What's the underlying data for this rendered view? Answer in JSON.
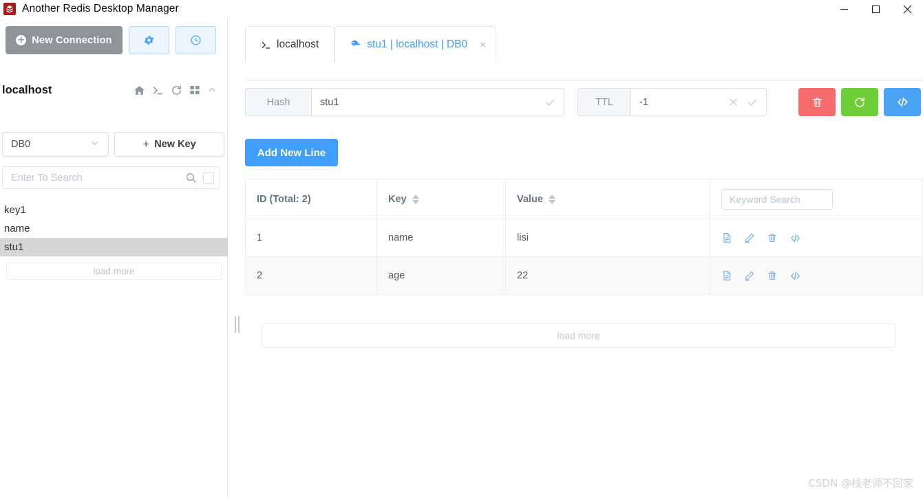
{
  "window": {
    "title": "Another Redis Desktop Manager",
    "icon": "redis-app-icon",
    "controls": {
      "minimize": "minimize-icon",
      "maximize": "maximize-icon",
      "close": "close-icon"
    }
  },
  "sidebar": {
    "new_connection_label": "New Connection",
    "settings_icon": "gear-icon",
    "history_icon": "clock-icon",
    "server_name": "localhost",
    "header_icons": [
      "home-icon",
      "terminal-icon",
      "refresh-icon",
      "grid-icon",
      "chevron-up-icon"
    ],
    "db_select_value": "DB0",
    "new_key_label": "New Key",
    "search_placeholder": "Enter To Search",
    "keys": [
      "key1",
      "name",
      "stu1"
    ],
    "selected_key": "stu1",
    "load_more_label": "load more"
  },
  "tabs": [
    {
      "label": "localhost",
      "icon": "terminal-icon",
      "active": false,
      "closable": false
    },
    {
      "label": "stu1 | localhost | DB0",
      "icon": "key-icon",
      "active": true,
      "closable": true,
      "close_label": "×"
    }
  ],
  "keybar": {
    "type_label": "Hash",
    "key_name": "stu1",
    "key_confirm_icon": "check-icon",
    "ttl_label": "TTL",
    "ttl_value": "-1",
    "ttl_clear_icon": "close-icon",
    "ttl_confirm_icon": "check-icon",
    "actions": [
      {
        "name": "delete-key-button",
        "icon": "trash-icon",
        "color": "#f56c6c"
      },
      {
        "name": "refresh-key-button",
        "icon": "refresh-icon",
        "color": "#6ece3a"
      },
      {
        "name": "code-view-button",
        "icon": "code-icon",
        "color": "#4ba3f5"
      }
    ]
  },
  "content": {
    "add_new_line_label": "Add New Line",
    "table": {
      "columns": [
        "ID (Total: 2)",
        "Key",
        "Value"
      ],
      "keyword_search_placeholder": "Keyword Search",
      "rows": [
        {
          "id": "1",
          "key": "name",
          "value": "lisi"
        },
        {
          "id": "2",
          "key": "age",
          "value": "22"
        }
      ],
      "row_action_icons": [
        "copy-icon",
        "edit-icon",
        "trash-icon",
        "code-icon"
      ]
    },
    "load_more_label": "load more"
  },
  "watermark": "CSDN @栈老师不回家",
  "colors": {
    "accent_blue": "#409eff",
    "danger_red": "#f56c6c",
    "success_green": "#6ece3a",
    "gray_button": "#909399"
  }
}
